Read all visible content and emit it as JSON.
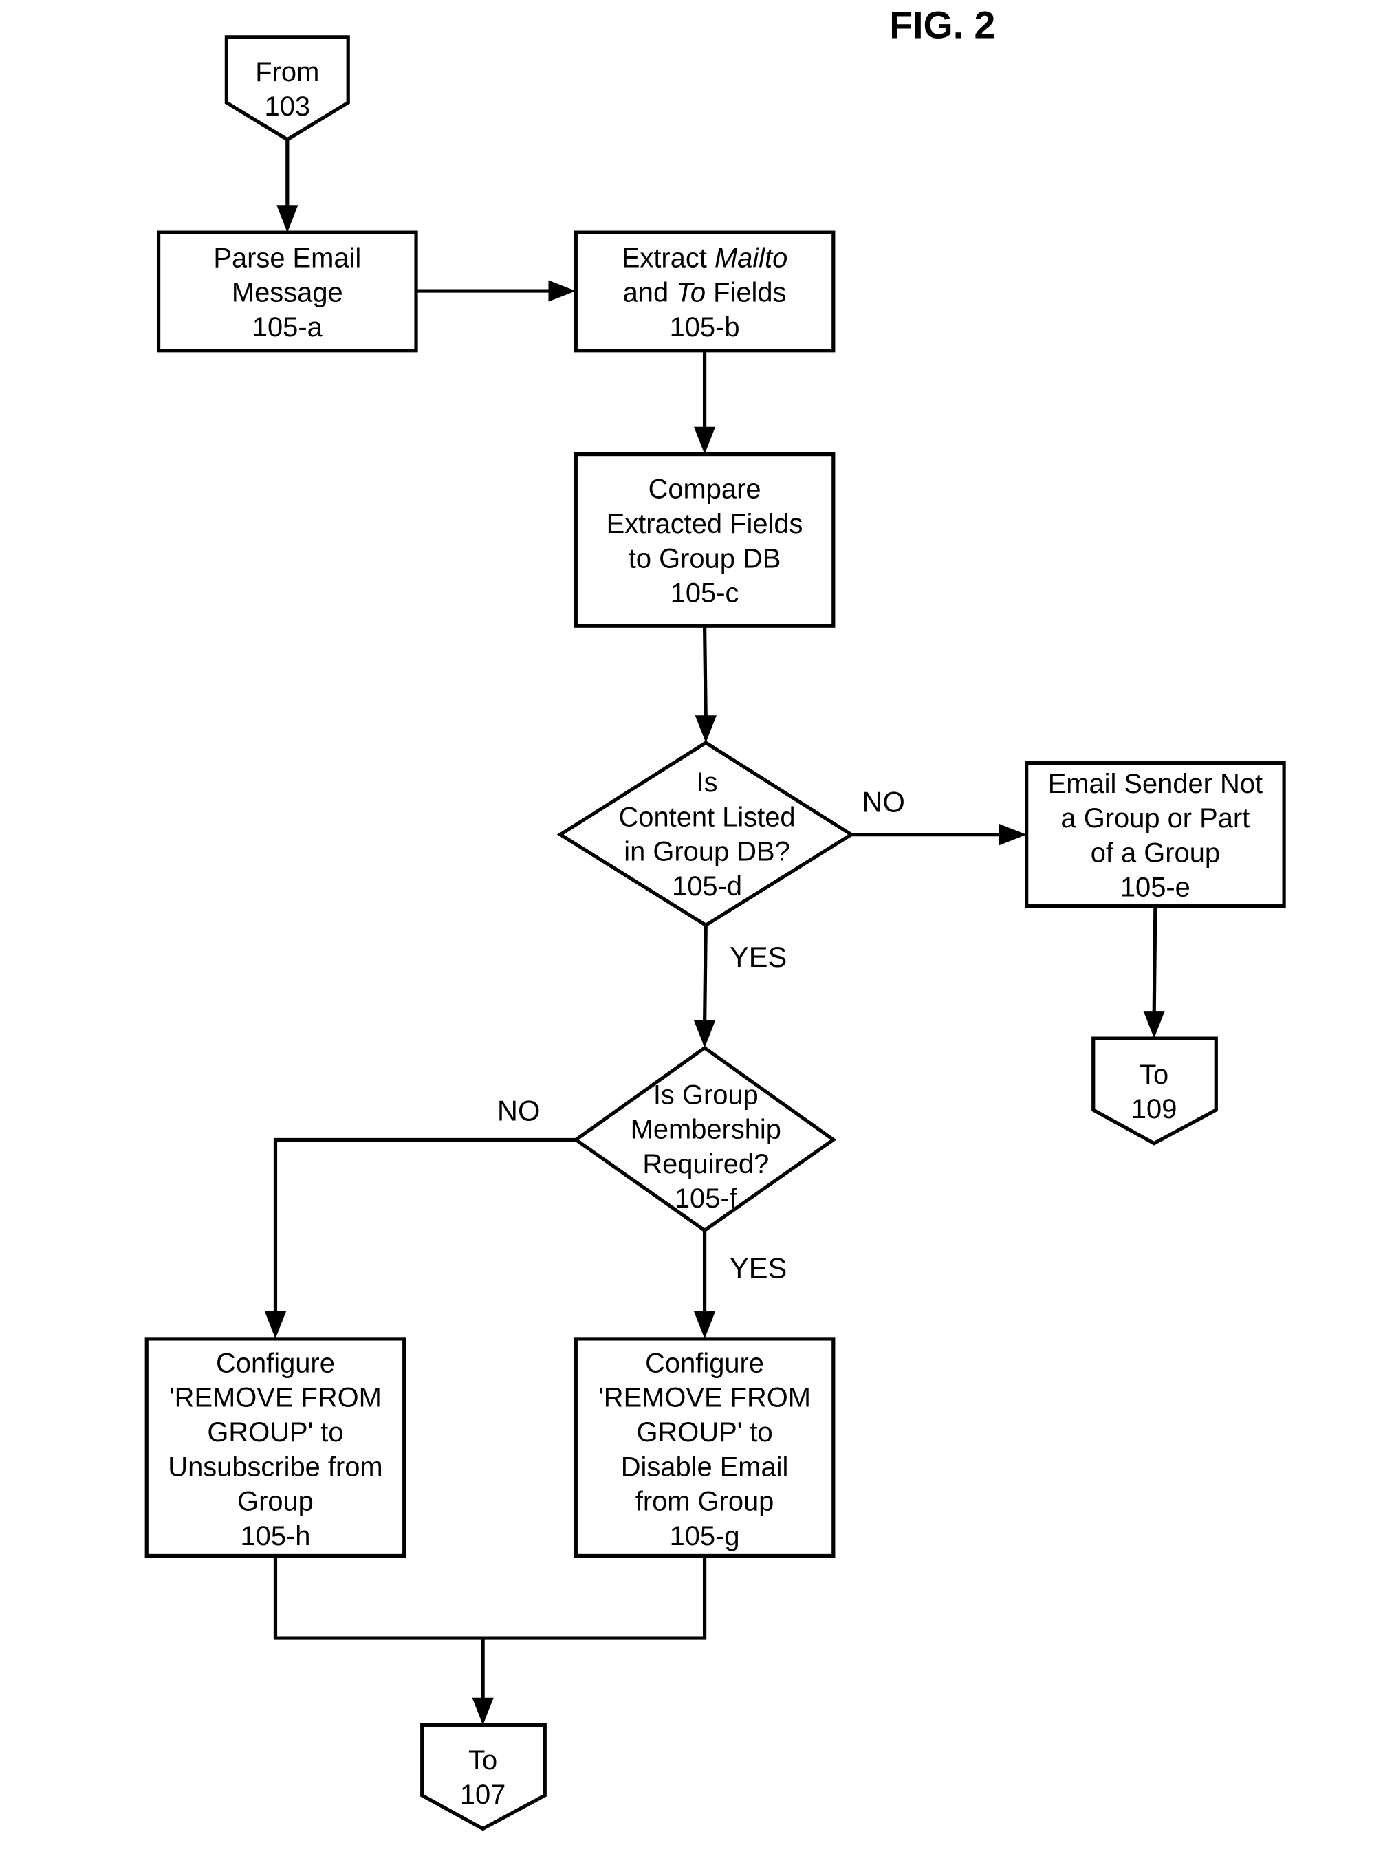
{
  "figure_title": "FIG. 2",
  "nodes": {
    "from_103": {
      "lines": [
        "From",
        "103"
      ]
    },
    "parse": {
      "lines": [
        "Parse Email",
        "Message",
        "105-a"
      ]
    },
    "extract": {
      "lines_rich": [
        [
          {
            "t": "Extract "
          },
          {
            "t": "Mailto",
            "i": true
          }
        ],
        [
          {
            "t": "and "
          },
          {
            "t": "To",
            "i": true
          },
          {
            "t": " Fields"
          }
        ],
        [
          {
            "t": "105-b"
          }
        ]
      ]
    },
    "compare": {
      "lines": [
        "Compare",
        "Extracted Fields",
        "to Group DB",
        "105-c"
      ]
    },
    "decision_d": {
      "lines": [
        "Is",
        "Content Listed",
        "in Group DB?",
        "105-d"
      ]
    },
    "sender_not": {
      "lines": [
        "Email Sender Not",
        "a Group or Part",
        "of  a Group",
        "105-e"
      ]
    },
    "to_109": {
      "lines": [
        "To",
        "109"
      ]
    },
    "decision_f": {
      "lines": [
        "Is Group",
        "Membership",
        "Required?",
        "105-f"
      ]
    },
    "unsubscribe": {
      "lines": [
        "Configure",
        "'REMOVE FROM",
        "GROUP' to",
        "Unsubscribe from",
        "Group",
        "105-h"
      ]
    },
    "disable": {
      "lines": [
        "Configure",
        "'REMOVE FROM",
        "GROUP' to",
        "Disable Email",
        "from Group",
        "105-g"
      ]
    },
    "to_107": {
      "lines": [
        "To",
        "107"
      ]
    }
  },
  "edge_labels": {
    "d_no": "NO",
    "d_yes": "YES",
    "f_no": "NO",
    "f_yes": "YES"
  }
}
